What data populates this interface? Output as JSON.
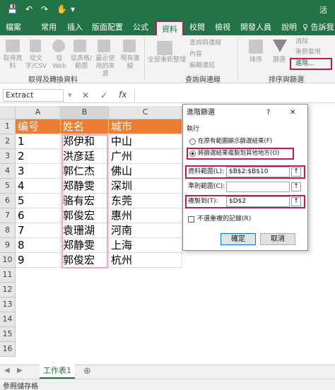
{
  "titlebar": {
    "qa_save": "💾",
    "qa_undo": "↶",
    "qa_redo": "↷",
    "qa_touch": "✋",
    "qa_dd": "▾",
    "search_short": "活"
  },
  "tabs": [
    "檔案",
    "常用",
    "插入",
    "版面配置",
    "公式",
    "資料",
    "校閱",
    "檢視",
    "開發人員",
    "說明"
  ],
  "tell_me": "♀ 告訴我",
  "ribbon": {
    "get_data": "取得資料",
    "from_text_csv": "從文字/CSV",
    "from_web": "從Web",
    "from_table": "從表格/範圍",
    "recent_sources": "最近使用的來源",
    "existing_connections": "現有連線",
    "refresh_all": "全部重新整理",
    "queries_connections": "查詢與連線",
    "properties": "內容",
    "edit_links": "編輯連結",
    "sort": "排序",
    "filter": "篩選",
    "clear": "清除",
    "reapply": "重新套用",
    "advanced": "進階...",
    "group_get_transform": "取得及轉換資料",
    "group_queries": "查詢與連線",
    "group_sort_filter": "排序與篩選"
  },
  "formula_bar": {
    "name_box": "Extract",
    "cancel": "✕",
    "confirm": "✓",
    "fx": "fx"
  },
  "columns": [
    "A",
    "B",
    "C"
  ],
  "rows": [
    "1",
    "2",
    "3",
    "4",
    "5",
    "6",
    "7",
    "8",
    "9",
    "10",
    "11",
    "12",
    "13",
    "14",
    "15",
    "16"
  ],
  "table": {
    "headers": [
      "编号",
      "姓名",
      "城市"
    ],
    "data": [
      [
        "1",
        "郑伊和",
        "中山"
      ],
      [
        "2",
        "洪彦廷",
        "广州"
      ],
      [
        "3",
        "郭仁杰",
        "佛山"
      ],
      [
        "4",
        "郑静雯",
        "深圳"
      ],
      [
        "5",
        "骆有宏",
        "东莞"
      ],
      [
        "6",
        "郭俊宏",
        "惠州"
      ],
      [
        "7",
        "袁珊湖",
        "河南"
      ],
      [
        "8",
        "郑静雯",
        "上海"
      ],
      [
        "9",
        "郭俊宏",
        "杭州"
      ]
    ]
  },
  "dialog": {
    "title": "進階篩選",
    "help": "?",
    "close": "✕",
    "action_label": "執行",
    "opt_in_place": "在原有範圍顯示篩選結果(F)",
    "opt_copy": "將篩選結果複製到其他地方(O)",
    "list_range_label": "資料範圍(L):",
    "list_range_value": "$B$2:$B$10",
    "criteria_label": "準則範圍(C):",
    "criteria_value": "",
    "copy_to_label": "複製到(T):",
    "copy_to_value": "$D$2",
    "unique_label": "不選重複的記錄(R)",
    "ok": "確定",
    "cancel": "取消"
  },
  "sheet_tab": "工作表1",
  "status": "參照儲存格",
  "colors": {
    "excel_green": "#217346",
    "header_orange": "#ed7d31",
    "highlight_pink": "#c2185b"
  }
}
